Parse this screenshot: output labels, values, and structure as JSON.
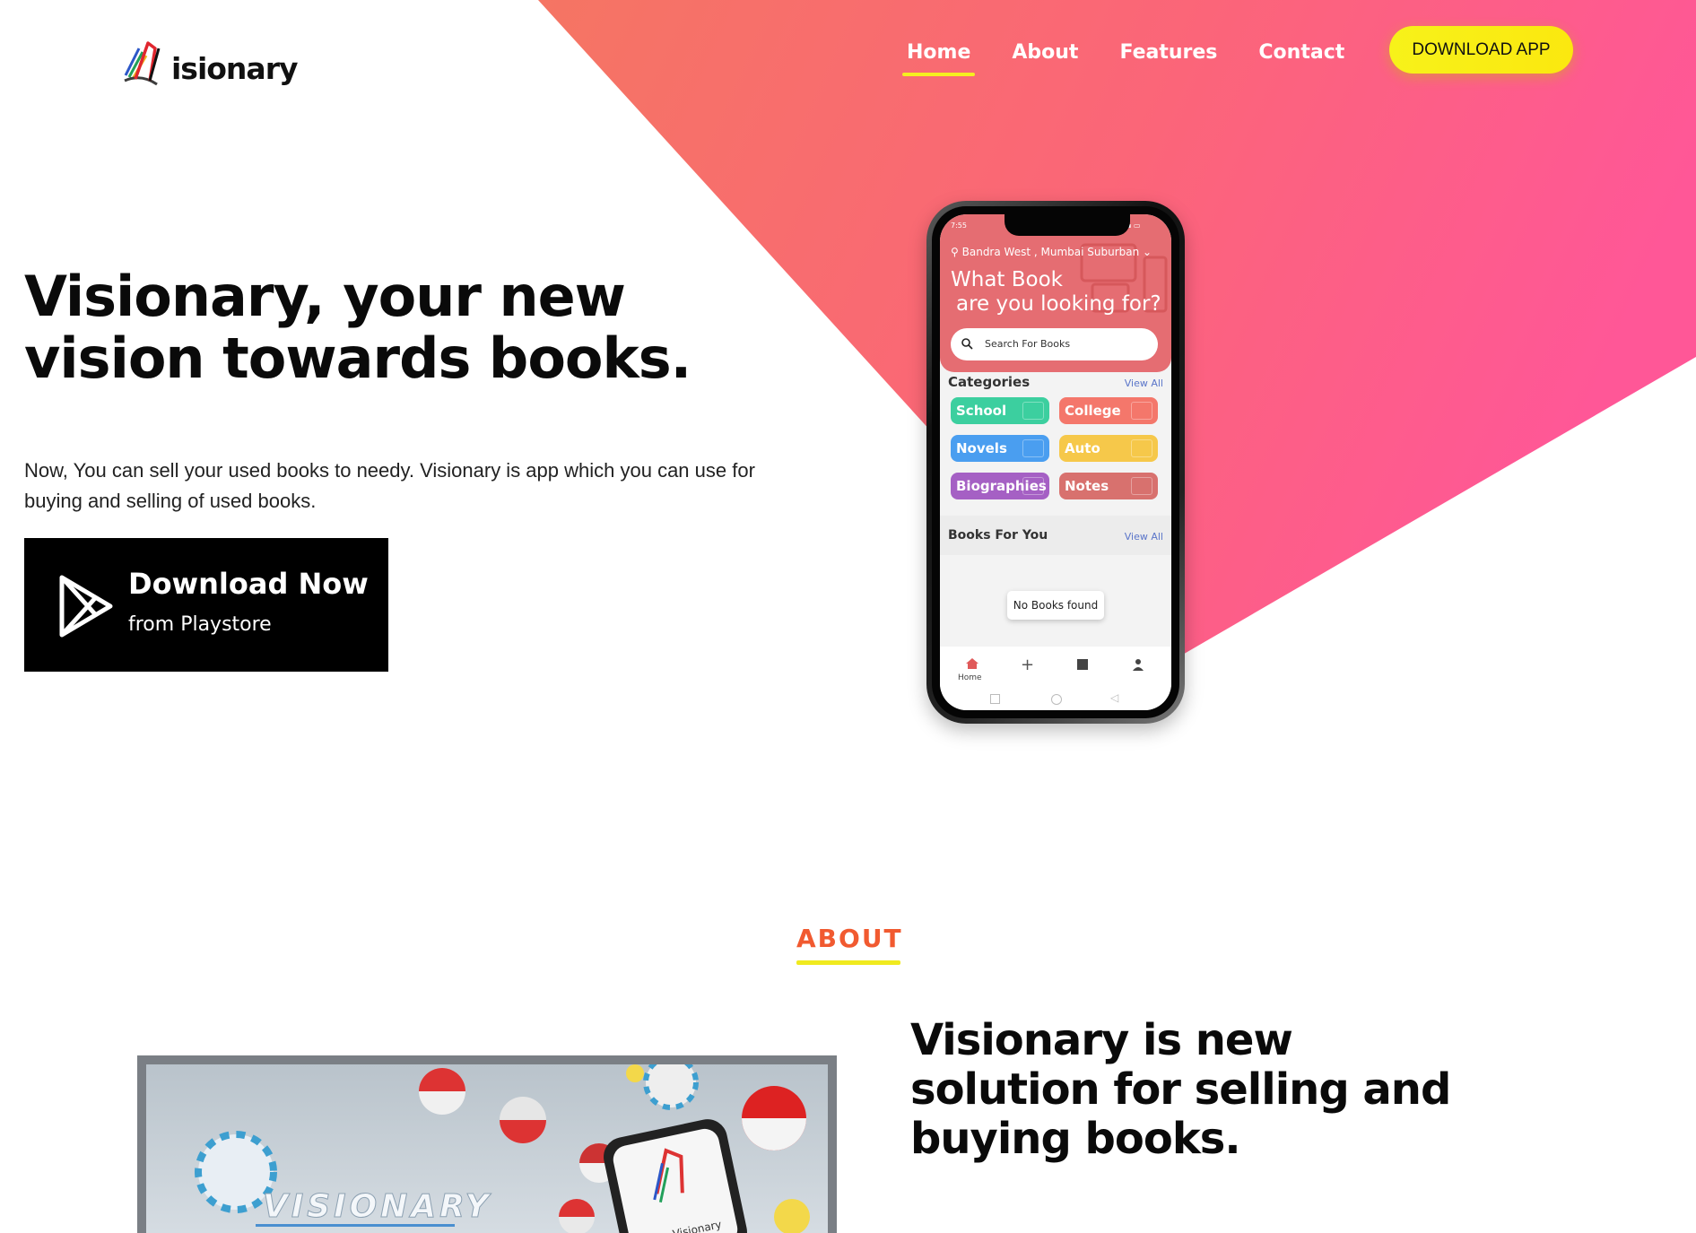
{
  "brand": {
    "logo_text": "isionary",
    "logo_icon": "book-v-logo-icon"
  },
  "nav": {
    "items": [
      {
        "label": "Home",
        "active": true
      },
      {
        "label": "About",
        "active": false
      },
      {
        "label": "Features",
        "active": false
      },
      {
        "label": "Contact",
        "active": false
      }
    ],
    "download_app_label": "DOWNLOAD APP"
  },
  "hero": {
    "title": "Visionary, your new vision towards books.",
    "description": "Now, You can sell your used books to needy. Visionary is app which you can use for buying and selling of used books.",
    "download_button": {
      "line1": "Download Now",
      "line2": "from Playstore",
      "icon": "play-store-icon"
    }
  },
  "phone_screen": {
    "status_time": "7:55",
    "location": "Bandra West , Mumbai Suburban",
    "question_line1": "What Book",
    "question_line2": "are you looking for?",
    "search_placeholder": "Search For Books",
    "categories_label": "Categories",
    "view_all": "View All",
    "categories": [
      {
        "label": "School",
        "color": "#3ccf9f"
      },
      {
        "label": "College",
        "color": "#f4776b"
      },
      {
        "label": "Novels",
        "color": "#4a9ef0"
      },
      {
        "label": "Auto",
        "color": "#f6c84a"
      },
      {
        "label": "Biographies",
        "color": "#a560c4"
      },
      {
        "label": "Notes",
        "color": "#d8716e"
      }
    ],
    "books_for_you_label": "Books For You",
    "no_books": "No Books found",
    "tab_home_label": "Home"
  },
  "about": {
    "heading": "ABOUT",
    "title": "Visionary is new solution for selling and buying books.",
    "video_watermark": "VISIONARY",
    "video_phone_label": "Visionary"
  },
  "colors": {
    "accent_yellow": "#f5ef20",
    "about_orange": "#f15a30",
    "gradient_start": "#f57563",
    "gradient_end": "#ff5797"
  }
}
